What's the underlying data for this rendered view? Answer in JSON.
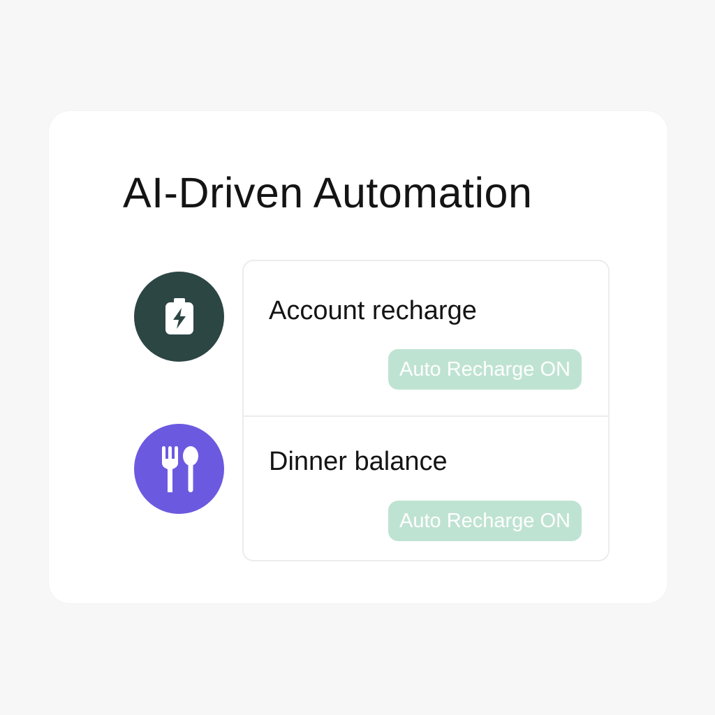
{
  "title": "AI-Driven Automation",
  "items": [
    {
      "label": "Account recharge",
      "icon": "battery-charging-icon",
      "icon_bg": "#2c4644",
      "badge": "Auto Recharge ON"
    },
    {
      "label": "Dinner balance",
      "icon": "fork-spoon-icon",
      "icon_bg": "#6b5ae0",
      "badge": "Auto Recharge ON"
    }
  ],
  "colors": {
    "badge_bg": "#bfe3d2",
    "badge_text": "#ffffff",
    "background": "#f7f7f7",
    "card": "#ffffff"
  }
}
